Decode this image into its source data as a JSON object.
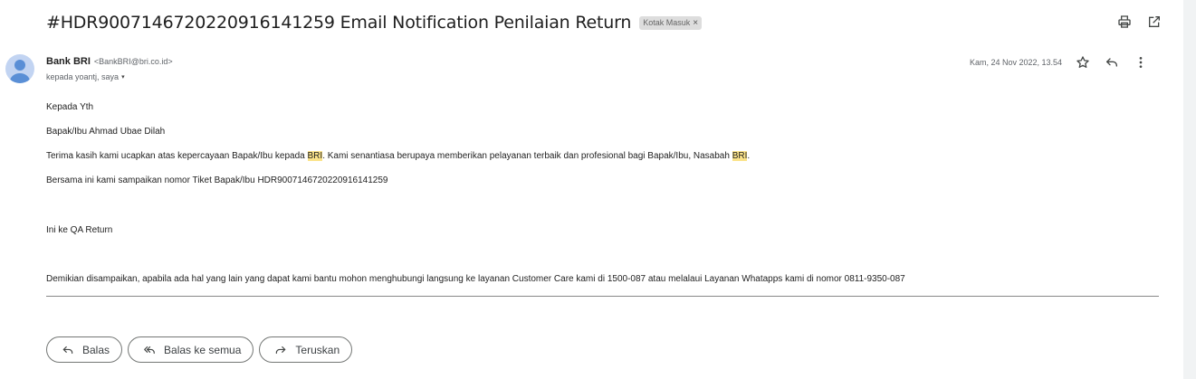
{
  "subject": {
    "title": "#HDR9007146720220916141259 Email Notification Penilaian Return",
    "label": "Kotak Masuk",
    "label_close": "×"
  },
  "toolbar": {
    "print_icon": "printer-icon",
    "popout_icon": "open-in-new-window-icon"
  },
  "sender": {
    "avatar_icon": "person-icon",
    "name": "Bank BRI",
    "email": "<BankBRI@bri.co.id>",
    "recipients": "kepada yoantj, saya",
    "caret": "▾"
  },
  "meta": {
    "date": "Kam, 24 Nov 2022, 13.54",
    "star_icon": "star-icon",
    "reply_icon": "reply-icon",
    "more_icon": "more-vertical-icon"
  },
  "body": {
    "line1": "Kepada Yth",
    "line2": "Bapak/Ibu Ahmad Ubae Dilah",
    "line3_a": "Terima kasih kami ucapkan atas kepercayaan Bapak/Ibu kepada ",
    "line3_hl1": "BRI",
    "line3_b": ". Kami senantiasa berupaya memberikan pelayanan terbaik dan profesional bagi Bapak/Ibu, Nasabah ",
    "line3_hl2": "BRI",
    "line3_c": ".",
    "line4": "Bersama ini kami sampaikan nomor Tiket Bapak/Ibu HDR9007146720220916141259",
    "line5": "Ini ke QA Return",
    "line6": "Demikian disampaikan, apabila ada hal yang lain yang dapat kami bantu mohon menghubungi langsung ke layanan Customer Care kami di 1500-087 atau melalaui Layanan Whatapps kami di nomor 0811-9350-087"
  },
  "actions": {
    "reply": "Balas",
    "reply_all": "Balas ke semua",
    "forward": "Teruskan"
  },
  "colors": {
    "highlight": "#fbe38a",
    "avatar_bg": "#c2d4f2",
    "avatar_fg": "#5a8fd6"
  }
}
